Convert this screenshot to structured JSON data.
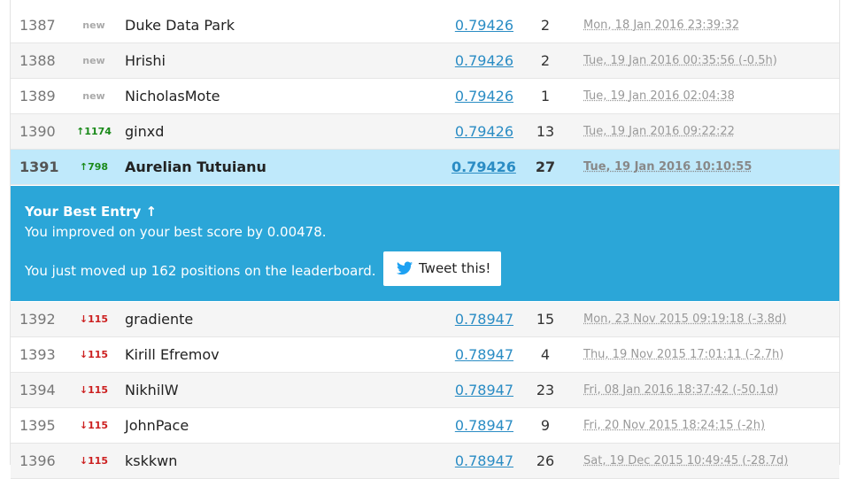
{
  "rows_top": [
    {
      "rank": "1387",
      "delta": "new",
      "delta_type": "new",
      "name": "Duke Data Park",
      "score": "0.79426",
      "entries": "2",
      "date": "Mon, 18 Jan 2016 23:39:32"
    },
    {
      "rank": "1388",
      "delta": "new",
      "delta_type": "new",
      "name": "Hrishi",
      "score": "0.79426",
      "entries": "2",
      "date": "Tue, 19 Jan 2016 00:35:56 (-0.5h)"
    },
    {
      "rank": "1389",
      "delta": "new",
      "delta_type": "new",
      "name": "NicholasMote",
      "score": "0.79426",
      "entries": "1",
      "date": "Tue, 19 Jan 2016 02:04:38"
    },
    {
      "rank": "1390",
      "delta": "↑1174",
      "delta_type": "up",
      "name": "ginxd",
      "score": "0.79426",
      "entries": "13",
      "date": "Tue, 19 Jan 2016 09:22:22"
    },
    {
      "rank": "1391",
      "delta": "↑798",
      "delta_type": "up",
      "name": "Aurelian Tutuianu",
      "score": "0.79426",
      "entries": "27",
      "date": "Tue, 19 Jan 2016 10:10:55"
    }
  ],
  "banner": {
    "title": "Your Best Entry ↑",
    "improved": "You improved on your best score by 0.00478.",
    "moved": "You just moved up 162 positions on the leaderboard.",
    "tweet_label": "Tweet this!",
    "color": "#2ba6d8"
  },
  "rows_bottom": [
    {
      "rank": "1392",
      "delta": "↓115",
      "delta_type": "down",
      "name": "gradiente",
      "score": "0.78947",
      "entries": "15",
      "date": "Mon, 23 Nov 2015 09:19:18 (-3.8d)"
    },
    {
      "rank": "1393",
      "delta": "↓115",
      "delta_type": "down",
      "name": "Kirill Efremov",
      "score": "0.78947",
      "entries": "4",
      "date": "Thu, 19 Nov 2015 17:01:11 (-2.7h)"
    },
    {
      "rank": "1394",
      "delta": "↓115",
      "delta_type": "down",
      "name": "NikhilW",
      "score": "0.78947",
      "entries": "23",
      "date": "Fri, 08 Jan 2016 18:37:42 (-50.1d)"
    },
    {
      "rank": "1395",
      "delta": "↓115",
      "delta_type": "down",
      "name": "JohnPace",
      "score": "0.78947",
      "entries": "9",
      "date": "Fri, 20 Nov 2015 18:24:15 (-2h)"
    },
    {
      "rank": "1396",
      "delta": "↓115",
      "delta_type": "down",
      "name": "kskkwn",
      "score": "0.78947",
      "entries": "26",
      "date": "Sat, 19 Dec 2015 10:49:45 (-28.7d)"
    }
  ],
  "highlight_rank": "1391",
  "colors": {
    "score_link": "#2a8cc4",
    "highlight_row": "#bfe9fb",
    "up": "#1a8a1a",
    "down": "#cc2020"
  }
}
